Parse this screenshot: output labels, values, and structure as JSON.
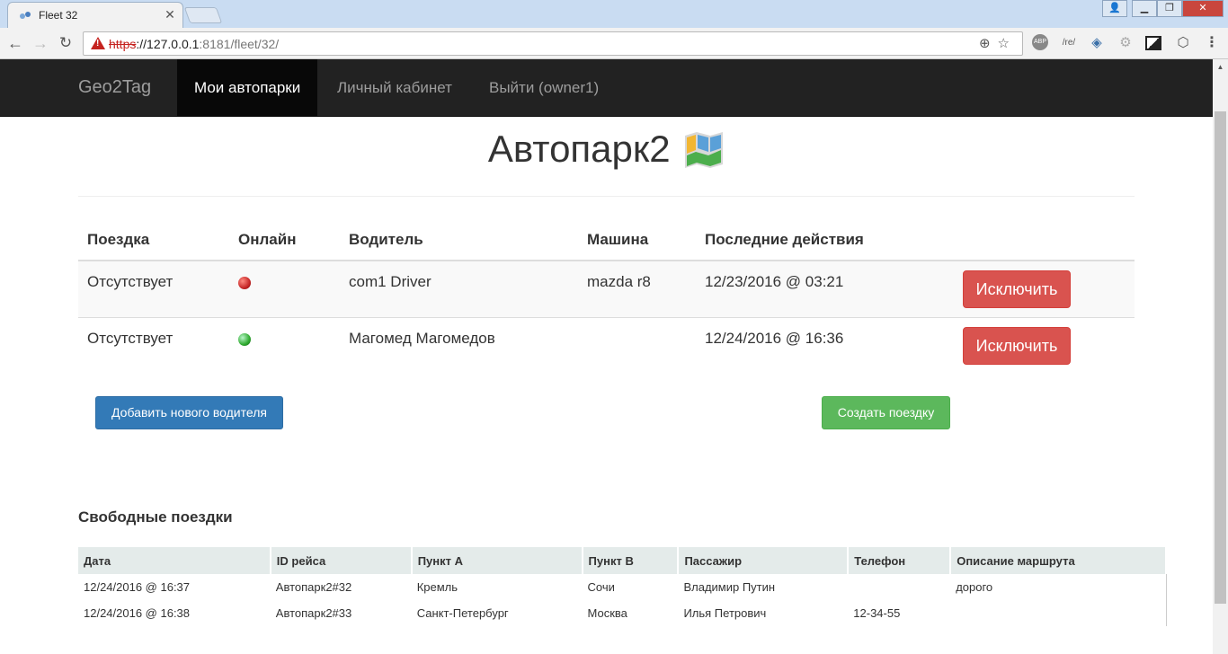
{
  "browser": {
    "tab_title": "Fleet 32",
    "url_protocol": "https",
    "url_host": "://127.0.0.1",
    "url_rest": ":8181/fleet/32/",
    "ext_abp": "ABP",
    "ext_re": "/re/"
  },
  "nav": {
    "brand": "Geo2Tag",
    "fleets": "Мои автопарки",
    "cabinet": "Личный кабинет",
    "logout": "Выйти (owner1)"
  },
  "page": {
    "title": "Автопарк2"
  },
  "drivers": {
    "headers": [
      "Поездка",
      "Онлайн",
      "Водитель",
      "Машина",
      "Последние действия"
    ],
    "rows": [
      {
        "trip": "Отсутствует",
        "online": false,
        "driver": "com1 Driver",
        "car": "mazda r8",
        "last_action": "12/23/2016 @ 03:21",
        "action_label": "Исключить"
      },
      {
        "trip": "Отсутствует",
        "online": true,
        "driver": "Магомед Магомедов",
        "car": "",
        "last_action": "12/24/2016 @ 16:36",
        "action_label": "Исключить"
      }
    ],
    "status_colors": {
      "online": "#2eaa2e",
      "offline": "#c62828"
    }
  },
  "buttons": {
    "add_driver": "Добавить нового водителя",
    "create_trip": "Создать поездку"
  },
  "free_trips": {
    "title": "Свободные поездки",
    "headers": [
      "Дата",
      "ID рейса",
      "Пункт А",
      "Пункт В",
      "Пассажир",
      "Телефон",
      "Описание маршрута"
    ],
    "rows": [
      [
        "12/24/2016 @ 16:37",
        "Автопарк2#32",
        "Кремль",
        "Сочи",
        "Владимир Путин",
        "",
        "дорого"
      ],
      [
        "12/24/2016 @ 16:38",
        "Автопарк2#33",
        "Санкт-Петербург",
        "Москва",
        "Илья Петрович",
        "12-34-55",
        ""
      ]
    ]
  },
  "colors": {
    "navbar": "#222222",
    "danger": "#d9534f",
    "primary": "#337ab7",
    "success": "#5cb85c"
  }
}
